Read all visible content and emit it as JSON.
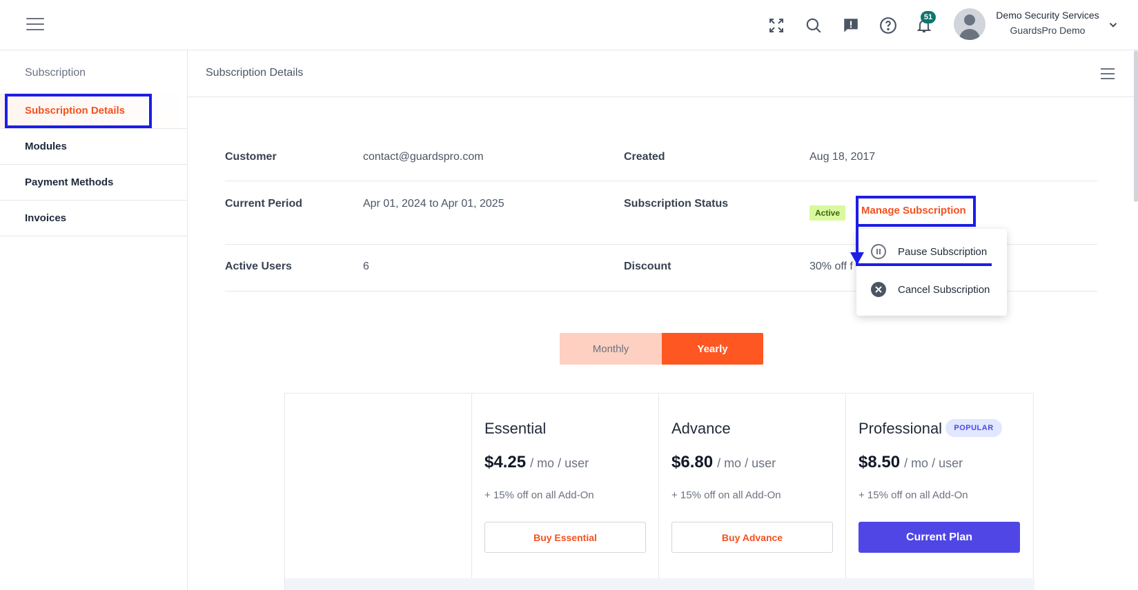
{
  "header": {
    "icons": [
      "expand-icon",
      "search-icon",
      "feedback-icon",
      "help-icon",
      "bell-icon"
    ],
    "notification_count": "51",
    "user_name": "Demo Security Services",
    "user_org": "GuardsPro Demo"
  },
  "sidebar": {
    "title": "Subscription",
    "items": [
      {
        "label": "Subscription Details",
        "active": true
      },
      {
        "label": "Modules",
        "active": false
      },
      {
        "label": "Payment Methods",
        "active": false
      },
      {
        "label": "Invoices",
        "active": false
      }
    ]
  },
  "main": {
    "title": "Subscription Details",
    "details": {
      "customer_label": "Customer",
      "customer_value": "contact@guardspro.com",
      "created_label": "Created",
      "created_value": "Aug 18, 2017",
      "period_label": "Current Period",
      "period_value": "Apr 01, 2024 to Apr 01, 2025",
      "status_label": "Subscription Status",
      "status_value": "Active",
      "manage_label": "Manage Subscription",
      "users_label": "Active Users",
      "users_value": "6",
      "discount_label": "Discount",
      "discount_value": "30% off f"
    },
    "dropdown": {
      "items": [
        {
          "label": "Pause Subscription",
          "icon": "pause-icon"
        },
        {
          "label": "Cancel Subscription",
          "icon": "cancel-icon"
        }
      ]
    },
    "billing_toggle": {
      "monthly": "Monthly",
      "yearly": "Yearly",
      "selected": "Yearly"
    },
    "plans": [
      {
        "name": "Essential",
        "price": "$4.25",
        "unit": "/ mo / user",
        "addon": "+ 15% off on all Add-On",
        "button": "Buy Essential",
        "current": false
      },
      {
        "name": "Advance",
        "price": "$6.80",
        "unit": "/ mo / user",
        "addon": "+ 15% off on all Add-On",
        "button": "Buy Advance",
        "current": false
      },
      {
        "name": "Professional",
        "price": "$8.50",
        "unit": "/ mo / user",
        "addon": "+ 15% off on all Add-On",
        "button": "Current Plan",
        "current": true,
        "badge": "POPULAR"
      }
    ]
  },
  "colors": {
    "accent": "#ff5722",
    "primary_button": "#4f46e5",
    "annotation": "#1d1de8",
    "status_active_bg": "#d9f99d"
  }
}
